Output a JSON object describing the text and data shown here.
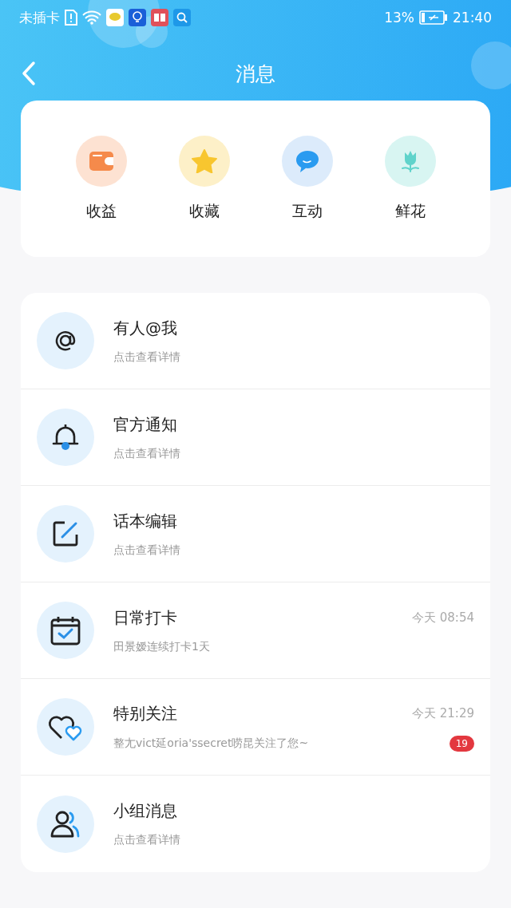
{
  "status_bar": {
    "carrier": "未插卡",
    "battery": "13%",
    "time": "21:40"
  },
  "header": {
    "title": "消息"
  },
  "shortcuts": [
    {
      "kind": "wallet",
      "label": "收益"
    },
    {
      "kind": "star",
      "label": "收藏"
    },
    {
      "kind": "chat",
      "label": "互动"
    },
    {
      "kind": "flower",
      "label": "鲜花"
    }
  ],
  "messages": [
    {
      "kind": "at",
      "title": "有人@我",
      "subtitle": "点击查看详情"
    },
    {
      "kind": "bell",
      "title": "官方通知",
      "subtitle": "点击查看详情"
    },
    {
      "kind": "edit",
      "title": "话本编辑",
      "subtitle": "点击查看详情"
    },
    {
      "kind": "calendar",
      "title": "日常打卡",
      "subtitle": "田景嫒连续打卡1天",
      "time": "今天 08:54"
    },
    {
      "kind": "hearts",
      "title": "特别关注",
      "subtitle": "整尢vict延oria'ssecret唠昆关注了您~",
      "time": "今天 21:29",
      "badge": "19"
    },
    {
      "kind": "group",
      "title": "小组消息",
      "subtitle": "点击查看详情"
    }
  ]
}
